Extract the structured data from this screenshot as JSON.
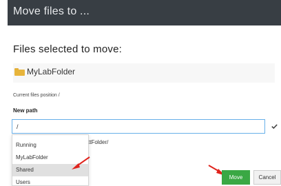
{
  "dialog": {
    "title": "Move files to ...",
    "files_heading": "Files selected to move:",
    "selected_folder": "MyLabFolder",
    "current_position": "Current files position /",
    "new_path_label": "New path",
    "new_path_value": "/",
    "path_hint_visible": "ttFolder/"
  },
  "dropdown": {
    "items": [
      {
        "label": "Running"
      },
      {
        "label": "MyLabFolder"
      },
      {
        "label": "Shared"
      },
      {
        "label": "Users"
      }
    ],
    "selected_label": "Shared"
  },
  "buttons": {
    "move": "Move",
    "cancel": "Cancel"
  },
  "colors": {
    "header_bg": "#383e44",
    "move_button": "#3aa844",
    "annotation_arrow": "#e0231c",
    "folder_icon": "#e7b43b"
  },
  "icons": {
    "folder": "folder-icon",
    "confirm": "checkmark-icon"
  }
}
